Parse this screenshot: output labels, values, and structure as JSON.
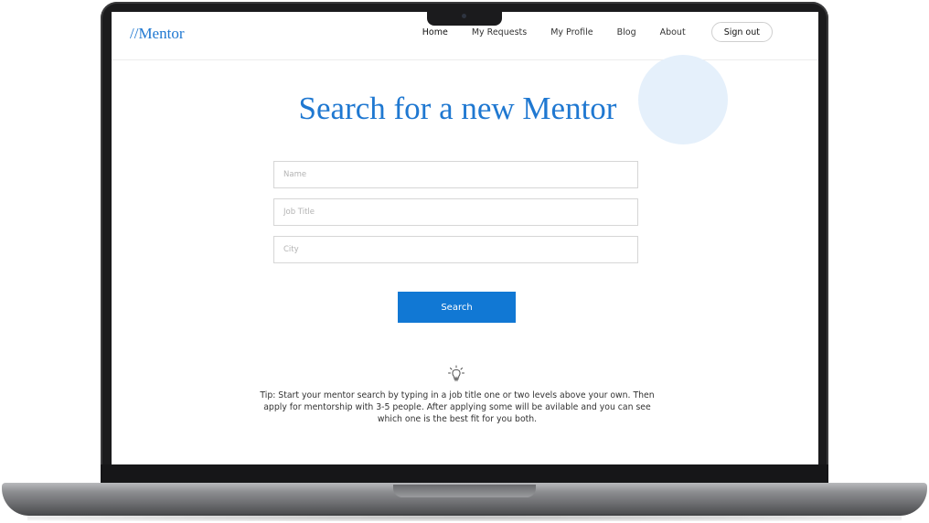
{
  "header": {
    "logo": "//Mentor",
    "nav": [
      {
        "label": "Home"
      },
      {
        "label": "My Requests"
      },
      {
        "label": "My Profile"
      },
      {
        "label": "Blog"
      },
      {
        "label": "About"
      }
    ],
    "signout_label": "Sign out"
  },
  "main": {
    "title": "Search for a new Mentor",
    "fields": {
      "name_placeholder": "Name",
      "job_title_placeholder": "Job Title",
      "city_placeholder": "City"
    },
    "search_label": "Search",
    "tip_icon": "lightbulb-icon",
    "tip_text": "Tip: Start your mentor search by typing in a job title one or two levels above your own. Then apply for mentorship with 3-5 people. After applying some will be avilable and you can see which one is the best fit for you both."
  },
  "colors": {
    "brand": "#1f78d1",
    "button": "#1178d4",
    "decorative_circle": "#e5f0fb"
  }
}
